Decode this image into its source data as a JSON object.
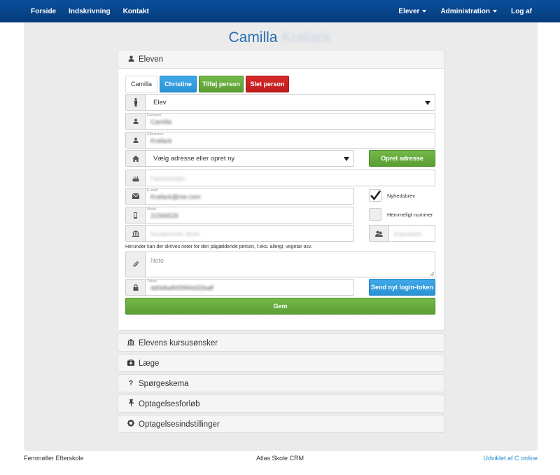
{
  "nav": {
    "left": [
      "Forside",
      "Indskrivning",
      "Kontakt"
    ],
    "right": [
      "Elever",
      "Administration",
      "Log af"
    ]
  },
  "page": {
    "title_first": "Camilla",
    "title_rest": "Krafack"
  },
  "panel_main": {
    "title": "Eleven",
    "icon": "user-icon"
  },
  "tabs": {
    "active": "Camilla",
    "other": "Christine",
    "add": "Tilføj person",
    "delete": "Slet person"
  },
  "form": {
    "role": {
      "value": "Elev"
    },
    "firstname": {
      "label": "Fornavn",
      "value": "Camilla"
    },
    "lastname": {
      "label": "Efternavn",
      "value": "Krafack"
    },
    "address": {
      "value": "Vælg adresse eller opret ny",
      "button": "Opret adresse"
    },
    "birthdate": {
      "placeholder": "Fødselsdato"
    },
    "email": {
      "label": "E-mail",
      "value": "Krafack@me.com"
    },
    "mobile": {
      "label": "Mobil",
      "value": "21566526"
    },
    "school": {
      "placeholder": "Nuværende skole"
    },
    "class": {
      "placeholder": "Klassetrin"
    },
    "newsletter": {
      "label": "Nyhedsbrev",
      "checked": true
    },
    "secret": {
      "label": "Hemmeligt nummer",
      "checked": false
    },
    "note_hint": "Herunder kan der skrives noter for den pågældende person, f.eks. allergi, vegetar osv.",
    "note": {
      "placeholder": "Note"
    },
    "token": {
      "label": "Token",
      "value": "dd0d6afbf3994d32baff",
      "button": "Send nyt login-token"
    },
    "save": "Gem"
  },
  "panels": [
    {
      "title": "Elevens kursusønsker",
      "icon": "bank-icon"
    },
    {
      "title": "Læge",
      "icon": "medkit-icon"
    },
    {
      "title": "Spørgeskema",
      "icon": "question-icon"
    },
    {
      "title": "Optagelsesforløb",
      "icon": "pin-icon"
    },
    {
      "title": "Optagelsesindstillinger",
      "icon": "gear-icon"
    }
  ],
  "footer": {
    "left": "Femmøller Efterskole",
    "center": "Atlas Skole CRM",
    "right": "Udviklet af C online"
  },
  "colors": {
    "nav": "#0a4f9c",
    "green": "#5a9e32",
    "blue": "#2a92d4",
    "red": "#c11c1c",
    "title": "#2a6fb0"
  }
}
